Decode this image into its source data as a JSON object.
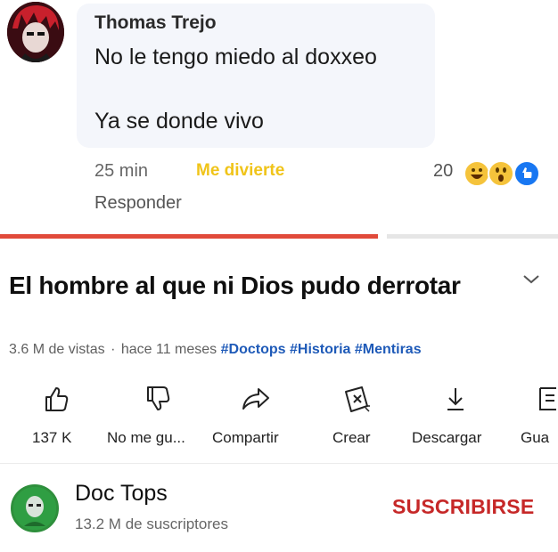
{
  "comment": {
    "author": "Thomas Trejo",
    "line1": "No le tengo miedo al doxxeo",
    "line2": "Ya se donde vivo",
    "time": "25 min",
    "react_link": "Me divierte",
    "reaction_count": "20",
    "reply_label": "Responder"
  },
  "video": {
    "title": "El hombre al que ni Dios pudo derrotar",
    "views": "3.6 M de vistas",
    "separator": "·",
    "age": "hace 11 meses",
    "hashtags": [
      "#Doctops",
      "#Historia",
      "#Mentiras"
    ],
    "progress_fraction": 0.68
  },
  "actions": {
    "like": "137 K",
    "dislike": "No me gu...",
    "share": "Compartir",
    "create": "Crear",
    "download": "Descargar",
    "save": "Gua"
  },
  "channel": {
    "name": "Doc Tops",
    "subscribers": "13.2 M de suscriptores",
    "subscribe_label": "SUSCRIBIRSE"
  },
  "colors": {
    "accent_red": "#c62828",
    "progress": "#e14a3a",
    "hashtag": "#1e5ab8",
    "react_yellow": "#f0c419"
  },
  "icons": [
    "haha-emoji-icon",
    "wow-emoji-icon",
    "like-reaction-icon",
    "chevron-down-icon",
    "thumbs-up-icon",
    "thumbs-down-icon",
    "share-icon",
    "create-icon",
    "download-icon",
    "save-icon"
  ]
}
